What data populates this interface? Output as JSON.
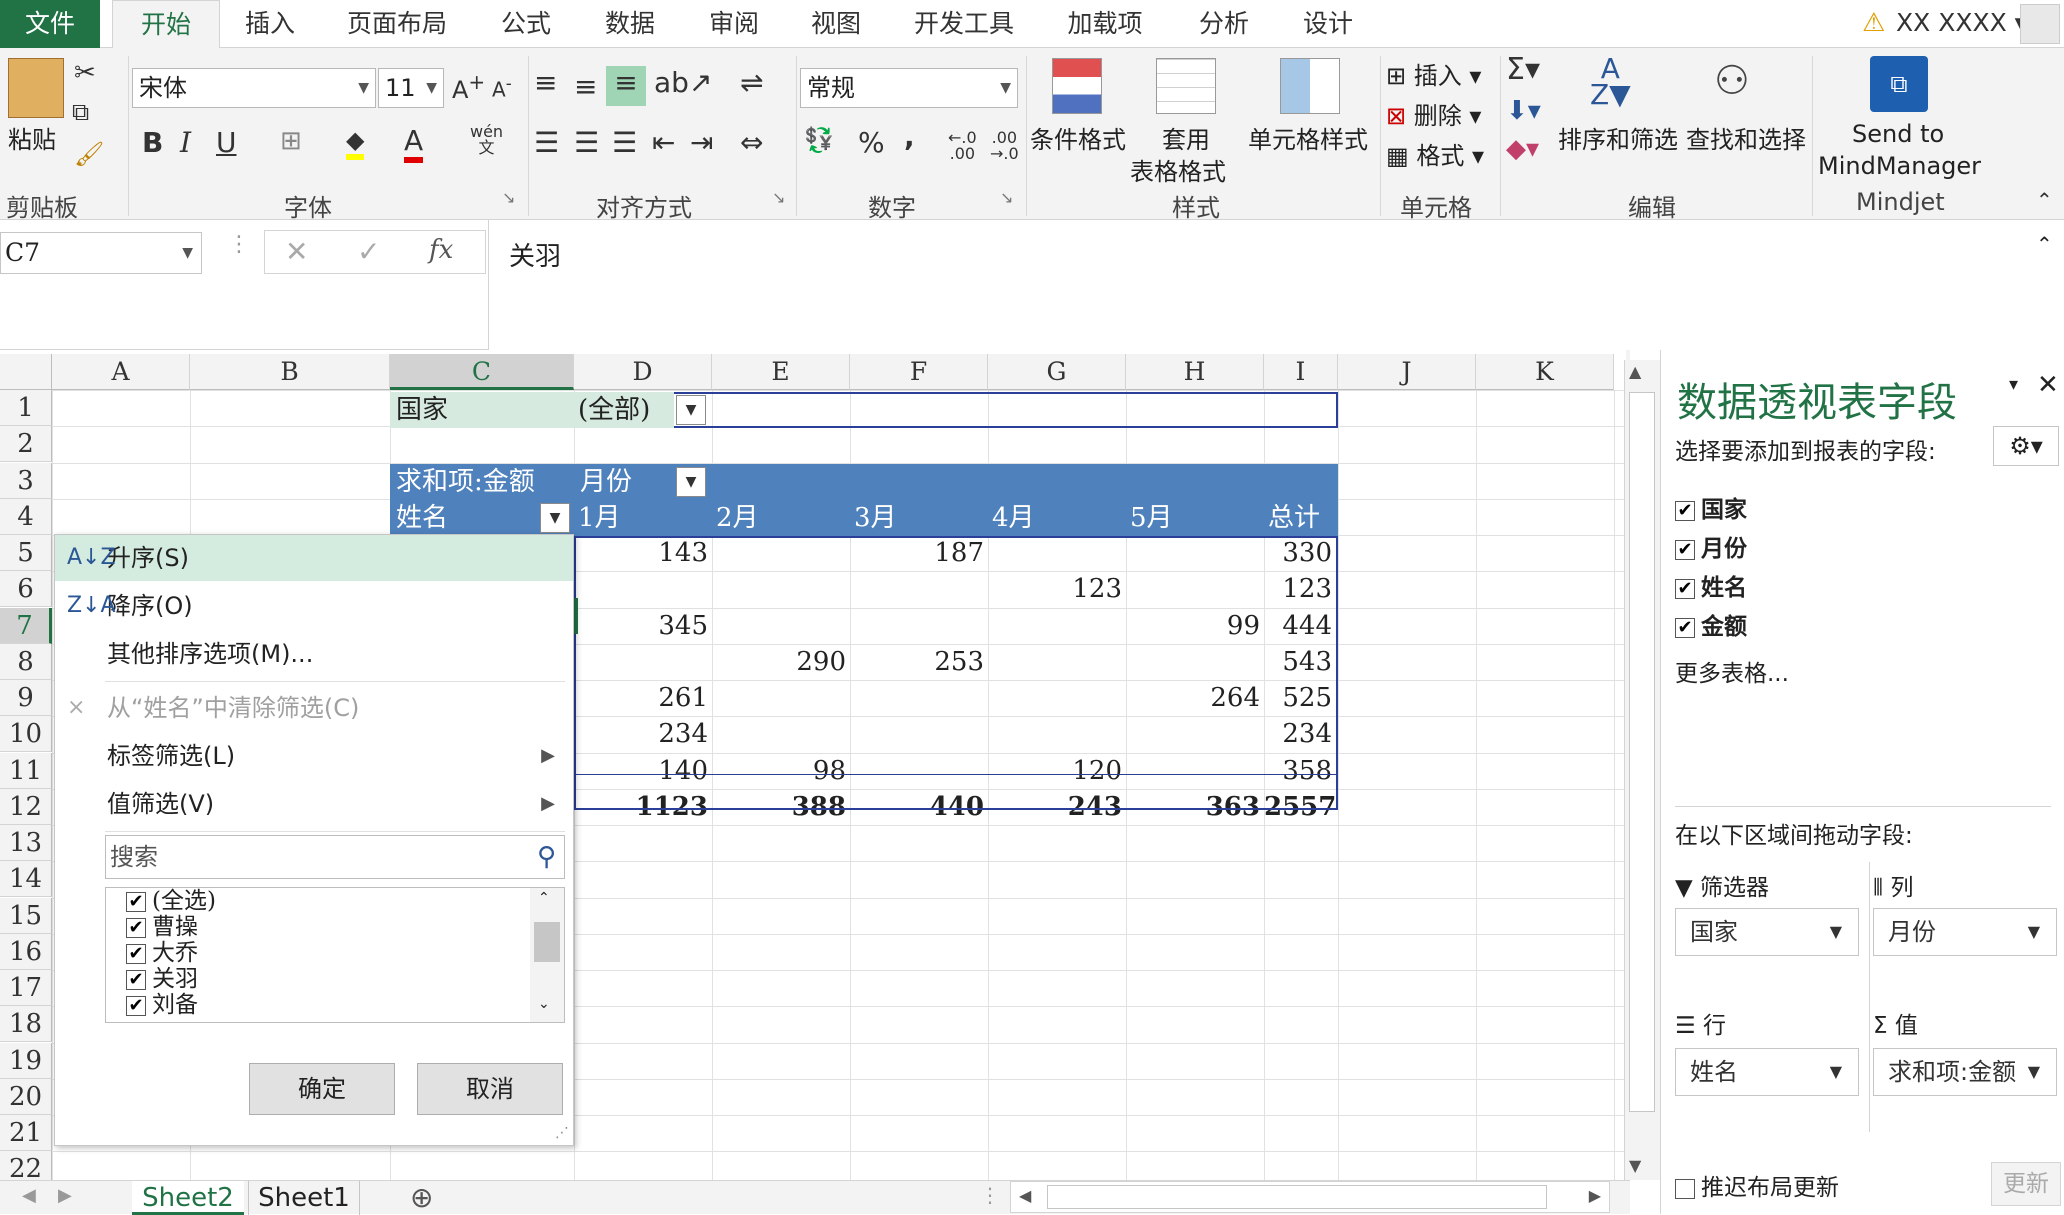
{
  "tabs": {
    "file": "文件",
    "items": [
      "开始",
      "插入",
      "页面布局",
      "公式",
      "数据",
      "审阅",
      "视图",
      "开发工具",
      "加载项",
      "分析",
      "设计"
    ],
    "user": "XX XXXX"
  },
  "ribbon": {
    "clipboard": {
      "paste": "粘贴",
      "label": "剪贴板"
    },
    "font": {
      "name": "宋体",
      "size": "11",
      "label": "字体",
      "pinyin": "wén"
    },
    "align": {
      "label": "对齐方式"
    },
    "number": {
      "format": "常规",
      "label": "数字",
      "pct": "%",
      "comma": ","
    },
    "styles": {
      "cond": "条件格式",
      "table1": "套用",
      "table2": "表格格式",
      "cell": "单元格样式",
      "label": "样式"
    },
    "cells": {
      "insert": "插入",
      "delete": "删除",
      "format": "格式",
      "label": "单元格"
    },
    "edit": {
      "sort": "排序和筛选",
      "find": "查找和选择",
      "label": "编辑"
    },
    "mindjet": {
      "line1": "Send to",
      "line2": "MindManager",
      "label": "Mindjet"
    }
  },
  "formula": {
    "namebox": "C7",
    "fx": "fx",
    "value": "关羽"
  },
  "columns": [
    "A",
    "B",
    "C",
    "D",
    "E",
    "F",
    "G",
    "H",
    "I",
    "J",
    "K"
  ],
  "rows": [
    "1",
    "2",
    "3",
    "4",
    "5",
    "6",
    "7",
    "8",
    "9",
    "10",
    "11",
    "12",
    "13",
    "14",
    "15",
    "16",
    "17",
    "18",
    "19",
    "20",
    "21",
    "22"
  ],
  "pivot": {
    "filter_field": "国家",
    "filter_value": "(全部)",
    "sum_label": "求和项:金额",
    "col_field": "月份",
    "row_field": "姓名",
    "months": [
      "1月",
      "2月",
      "3月",
      "4月",
      "5月"
    ],
    "total_label": "总计",
    "rows": [
      [
        "143",
        "",
        "187",
        "",
        "",
        "330"
      ],
      [
        "",
        "",
        "",
        "123",
        "",
        "123"
      ],
      [
        "345",
        "",
        "",
        "",
        "99",
        "444"
      ],
      [
        "",
        "290",
        "253",
        "",
        "",
        "543"
      ],
      [
        "261",
        "",
        "",
        "",
        "264",
        "525"
      ],
      [
        "234",
        "",
        "",
        "",
        "",
        "234"
      ],
      [
        "140",
        "98",
        "",
        "120",
        "",
        "358"
      ]
    ],
    "totals": [
      "1123",
      "388",
      "440",
      "243",
      "363",
      "2557"
    ]
  },
  "menu": {
    "asc": "升序(S)",
    "desc": "降序(O)",
    "more_sort": "其他排序选项(M)...",
    "clear": "从“姓名”中清除筛选(C)",
    "label_filter": "标签筛选(L)",
    "value_filter": "值筛选(V)",
    "search_placeholder": "搜索",
    "list": [
      "(全选)",
      "曹操",
      "大乔",
      "关羽",
      "刘备"
    ],
    "ok": "确定",
    "cancel": "取消"
  },
  "panel": {
    "title": "数据透视表字段",
    "subtitle": "选择要添加到报表的字段:",
    "fields": [
      "国家",
      "月份",
      "姓名",
      "金额"
    ],
    "more": "更多表格...",
    "drag": "在以下区域间拖动字段:",
    "filters_label": "筛选器",
    "columns_label": "列",
    "rows_label": "行",
    "values_label": "值",
    "filters_value": "国家",
    "columns_value": "月份",
    "rows_value": "姓名",
    "values_value": "求和项:金额",
    "defer": "推迟布局更新",
    "update": "更新"
  },
  "sheets": [
    "Sheet2",
    "Sheet1"
  ],
  "colors": {
    "accent": "#217346",
    "pivot_header": "#4f81bd",
    "pivot_filter": "#d6eadf",
    "menu_hover": "#d4ebe0"
  }
}
